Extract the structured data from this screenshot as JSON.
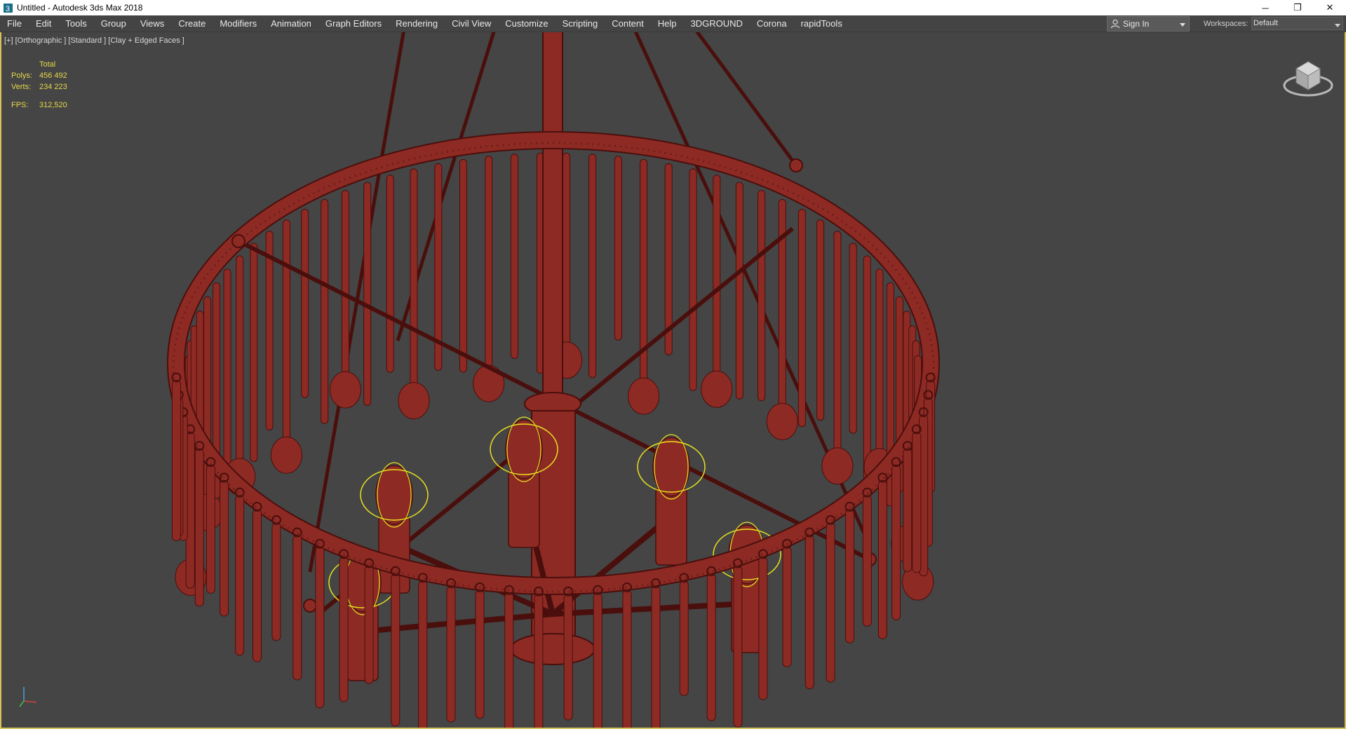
{
  "window": {
    "title": "Untitled - Autodesk 3ds Max 2018",
    "controls": {
      "minimize": "─",
      "restore": "❐",
      "close": "✕"
    }
  },
  "menu": {
    "items": [
      "File",
      "Edit",
      "Tools",
      "Group",
      "Views",
      "Create",
      "Modifiers",
      "Animation",
      "Graph Editors",
      "Rendering",
      "Civil View",
      "Customize",
      "Scripting",
      "Content",
      "Help",
      "3DGROUND",
      "Corona",
      "rapidTools"
    ]
  },
  "account": {
    "sign_in": "Sign In"
  },
  "workspaces": {
    "label": "Workspaces:",
    "value": "Default"
  },
  "viewport": {
    "label": "[+] [Orthographic ] [Standard ] [Clay + Edged Faces ]",
    "stats": {
      "header": "Total",
      "polys_label": "Polys:",
      "polys_value": "456 492",
      "verts_label": "Verts:",
      "verts_value": "234 223",
      "fps_label": "FPS:",
      "fps_value": "312,520"
    },
    "colors": {
      "background": "#454545",
      "model": "#8e2a24",
      "wire": "#4a0f0c",
      "selection": "#e8e020",
      "border": "#d8c35a"
    },
    "icons": {
      "viewcube": "viewcube-icon",
      "tripod": "axis-tripod-icon"
    }
  }
}
